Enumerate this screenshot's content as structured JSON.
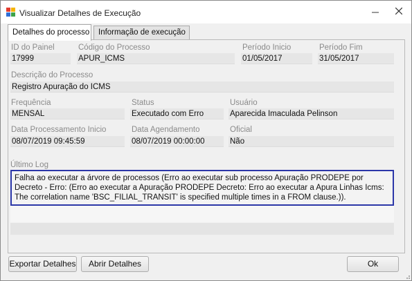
{
  "window": {
    "title": "Visualizar Detalhes de Execução"
  },
  "tabs": [
    {
      "label": "Detalhes do processo",
      "active": true
    },
    {
      "label": "Informação de execução",
      "active": false
    }
  ],
  "fields": {
    "id_painel": {
      "label": "ID do Painel",
      "value": "17999"
    },
    "codigo_processo": {
      "label": "Código do Processo",
      "value": "APUR_ICMS"
    },
    "periodo_inicio": {
      "label": "Período Inicio",
      "value": "01/05/2017"
    },
    "periodo_fim": {
      "label": "Período Fim",
      "value": "31/05/2017"
    },
    "descricao": {
      "label": "Descrição do Processo",
      "value": "Registro Apuração do ICMS"
    },
    "frequencia": {
      "label": "Frequência",
      "value": "MENSAL"
    },
    "status": {
      "label": "Status",
      "value": "Executado com Erro"
    },
    "usuario": {
      "label": "Usuário",
      "value": "Aparecida Imaculada Pelinson"
    },
    "data_proc_inicio": {
      "label": "Data Processamento Inicio",
      "value": "08/07/2019 09:45:59"
    },
    "data_agendamento": {
      "label": "Data Agendamento",
      "value": "08/07/2019 00:00:00"
    },
    "oficial": {
      "label": "Oficial",
      "value": "Não"
    }
  },
  "log": {
    "label": "Último Log",
    "text": "Falha ao executar a árvore de processos (Erro ao executar sub processo Apuração PRODEPE por Decreto - Erro: (Erro ao executar a Apuração PRODEPE Decreto: Erro ao executar a Apura Linhas Icms: The correlation name 'BSC_FILIAL_TRANSIT' is specified multiple times in a FROM clause.))."
  },
  "buttons": {
    "export": "Exportar Detalhes",
    "open": "Abrir Detalhes",
    "ok": "Ok"
  },
  "colors": {
    "log_border": "#2b36a8",
    "field_bg": "#e6e6e6",
    "label": "#8a8a8a"
  },
  "icons": {
    "app": "window-app-icon",
    "minimize": "minimize-icon",
    "close": "close-icon"
  }
}
